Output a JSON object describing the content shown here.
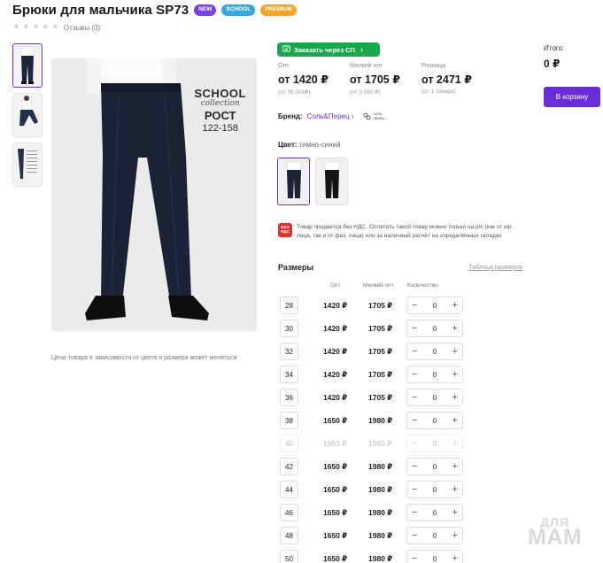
{
  "product": {
    "title": "Брюки для мальчика SP73",
    "badges": [
      {
        "label": "NEW",
        "color": "#7b3fe4"
      },
      {
        "label": "SCHOOL",
        "color": "#36a8e0"
      },
      {
        "label": "PREMIUM",
        "color": "#f5a524"
      }
    ],
    "reviews_label": "Отзывы (0)",
    "rating_stars": 0
  },
  "gallery": {
    "photo_text": {
      "line1": "SCHOOL",
      "line2": "collection",
      "line3": "РОСТ",
      "line4": "122-158"
    },
    "note": "Цена товара в зависимости от цвета и размера может меняться"
  },
  "sp_button": {
    "label": "Заказать через СП"
  },
  "prices": [
    {
      "label": "Опт",
      "value": "от 1420 ₽",
      "sub": "(от 35 000₽)"
    },
    {
      "label": "Мелкий опт",
      "value": "от 1705 ₽",
      "sub": "(от 5 000 ₽)"
    },
    {
      "label": "Розница",
      "value": "от 2471 ₽",
      "sub": "(от 1 товара)"
    }
  ],
  "brand": {
    "label": "Бренд:",
    "name": "Соль&Перец",
    "logo_text_1": "соль",
    "logo_text_2": "перец"
  },
  "color": {
    "label": "Цвет:",
    "value": "темно-синий"
  },
  "vat": {
    "icon_line1": "БЕЗ",
    "icon_line2": "НДС",
    "text": "Товар продается без НДС. Оплатить такой товар можно только на р/с (как от юр. лица, так и от физ. лица) или за наличный расчёт на определённых складах"
  },
  "sizes": {
    "title": "Размеры",
    "table_link": "Таблица размеров",
    "col_opt": "Опт",
    "col_small": "Мелкий опт",
    "col_qty": "Количество",
    "rows": [
      {
        "size": "28",
        "opt": "1420 ₽",
        "small": "1705 ₽",
        "qty": "0",
        "available": true
      },
      {
        "size": "30",
        "opt": "1420 ₽",
        "small": "1705 ₽",
        "qty": "0",
        "available": true
      },
      {
        "size": "32",
        "opt": "1420 ₽",
        "small": "1705 ₽",
        "qty": "0",
        "available": true
      },
      {
        "size": "34",
        "opt": "1420 ₽",
        "small": "1705 ₽",
        "qty": "0",
        "available": true
      },
      {
        "size": "36",
        "opt": "1420 ₽",
        "small": "1705 ₽",
        "qty": "0",
        "available": true
      },
      {
        "size": "38",
        "opt": "1650 ₽",
        "small": "1980 ₽",
        "qty": "0",
        "available": true
      },
      {
        "size": "40",
        "opt": "1650 ₽",
        "small": "1980 ₽",
        "qty": "0",
        "available": false
      },
      {
        "size": "42",
        "opt": "1650 ₽",
        "small": "1980 ₽",
        "qty": "0",
        "available": true
      },
      {
        "size": "44",
        "opt": "1650 ₽",
        "small": "1980 ₽",
        "qty": "0",
        "available": true
      },
      {
        "size": "46",
        "opt": "1650 ₽",
        "small": "1980 ₽",
        "qty": "0",
        "available": true
      },
      {
        "size": "48",
        "opt": "1650 ₽",
        "small": "1980 ₽",
        "qty": "0",
        "available": true
      },
      {
        "size": "50",
        "opt": "1650 ₽",
        "small": "1980 ₽",
        "qty": "0",
        "available": true
      }
    ]
  },
  "cart": {
    "total_label": "Итого:",
    "total_value": "0 ₽",
    "button": "В корзину"
  },
  "watermark": {
    "line1": "ДЛЯ",
    "line2": "МАМ"
  },
  "colors": {
    "accent": "#6a2ed8",
    "green": "#17a84b",
    "red": "#e03131"
  }
}
